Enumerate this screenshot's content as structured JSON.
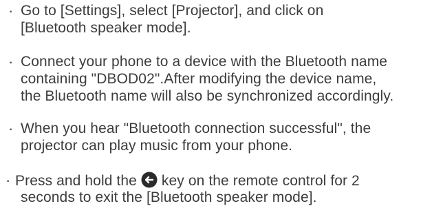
{
  "items": [
    {
      "lines": [
        "Go to [Settings], select [Projector], and click on",
        "[Bluetooth speaker mode]."
      ]
    },
    {
      "lines": [
        "Connect your phone to a device with the Bluetooth name",
        "containing \"DBOD02\".After modifying the device name,",
        "the Bluetooth name will also be synchronized accordingly."
      ]
    },
    {
      "lines": [
        "When you hear \"Bluetooth connection successful\", the",
        "projector can play music from your phone."
      ]
    },
    {
      "line1_before_icon": "Press and hold the",
      "line1_after_icon": "key on the remote control for 2",
      "line2": "seconds to exit the [Bluetooth speaker mode].",
      "icon": "back-arrow-key-icon"
    }
  ],
  "colors": {
    "text": "#3c3c3c",
    "icon_bg": "#2b2b2b",
    "icon_fg": "#ffffff"
  }
}
